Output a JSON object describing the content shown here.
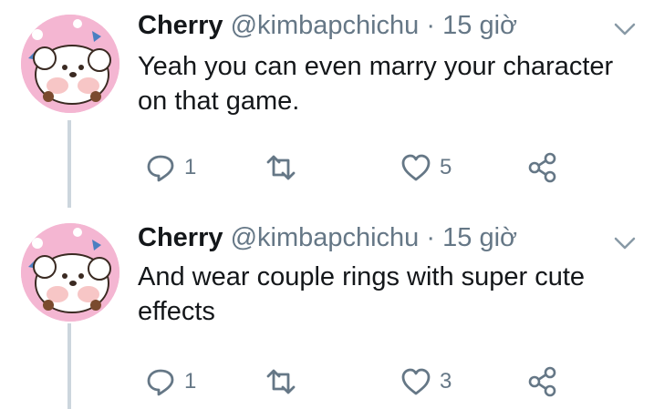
{
  "tweets": [
    {
      "author_name": "Cherry",
      "handle": "@kimbapchichu",
      "separator": "·",
      "time": "15 giờ",
      "text_line1": "Yeah you can even marry your character",
      "text_line2": "on that game.",
      "replies": "1",
      "likes": "5",
      "icons": {
        "reply": "reply-icon",
        "retweet": "retweet-icon",
        "like": "heart-icon",
        "share": "share-icon",
        "menu": "chevron-down-icon"
      }
    },
    {
      "author_name": "Cherry",
      "handle": "@kimbapchichu",
      "separator": "·",
      "time": "15 giờ",
      "text_line1": "And wear couple rings with super cute",
      "text_line2": "effects",
      "replies": "1",
      "likes": "3",
      "icons": {
        "reply": "reply-icon",
        "retweet": "retweet-icon",
        "like": "heart-icon",
        "share": "share-icon",
        "menu": "chevron-down-icon"
      }
    }
  ],
  "colors": {
    "text": "#14171a",
    "muted": "#657786",
    "thread_line": "#ccd6dd",
    "avatar_bg": "#f4b6d2"
  }
}
